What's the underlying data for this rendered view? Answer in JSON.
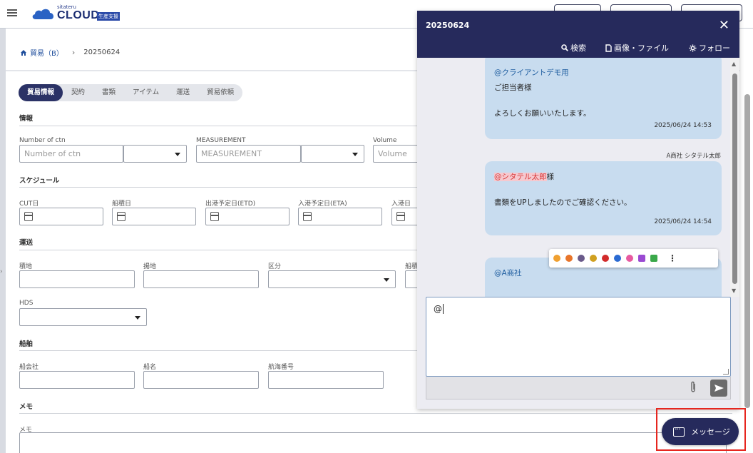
{
  "header": {
    "brand_small": "sitateru",
    "brand_name": "CLOUD",
    "brand_badge": "生産支援"
  },
  "breadcrumb": {
    "home_label": "貿易（B）",
    "current": "20250624"
  },
  "tabs": [
    "貿易情報",
    "契約",
    "書類",
    "アイテム",
    "運送",
    "貿易依頼"
  ],
  "sections": {
    "info": "情報",
    "schedule": "スケジュール",
    "transport": "運送",
    "ship": "船舶",
    "memo": "メモ"
  },
  "fields": {
    "number_of_ctn": {
      "label": "Number of ctn",
      "placeholder": "Number of ctn"
    },
    "measurement": {
      "label": "MEASUREMENT",
      "placeholder": "MEASUREMENT"
    },
    "volume": {
      "label": "Volume",
      "placeholder": "Volume"
    },
    "cut_date": "CUT日",
    "loading_date": "船積日",
    "etd": "出港予定日(ETD)",
    "eta": "入港予定日(ETA)",
    "arrival_date": "入港日",
    "loading_port": "積地",
    "unloading_port": "揚地",
    "category": "区分",
    "ship_partial": "船積",
    "hds": "HDS",
    "shipping_company": "船会社",
    "ship_name": "船名",
    "voyage_no": "航海番号",
    "memo": "メモ"
  },
  "chat": {
    "title": "20250624",
    "actions": {
      "search": "検索",
      "files": "画像・ファイル",
      "follow": "フォロー"
    },
    "messages": [
      {
        "mention": "@クライアントデモ用",
        "line1": "ご担当者様",
        "line2": "よろしくお願いいたします。",
        "time": "2025/06/24 14:53"
      },
      {
        "sender": "A商社 シタテル太郎",
        "mention": "@シタテル太郎",
        "mention_suffix": "様",
        "line1": "書類をUPしましたのでご確認ください。",
        "time": "2025/06/24 14:54"
      },
      {
        "mention": "@A商社"
      }
    ],
    "compose_value": "@"
  },
  "message_button": {
    "label": "メッセージ"
  },
  "colors": {
    "navy": "#262a5c",
    "bubble": "#c8dcef",
    "highlight": "#e6261f"
  }
}
